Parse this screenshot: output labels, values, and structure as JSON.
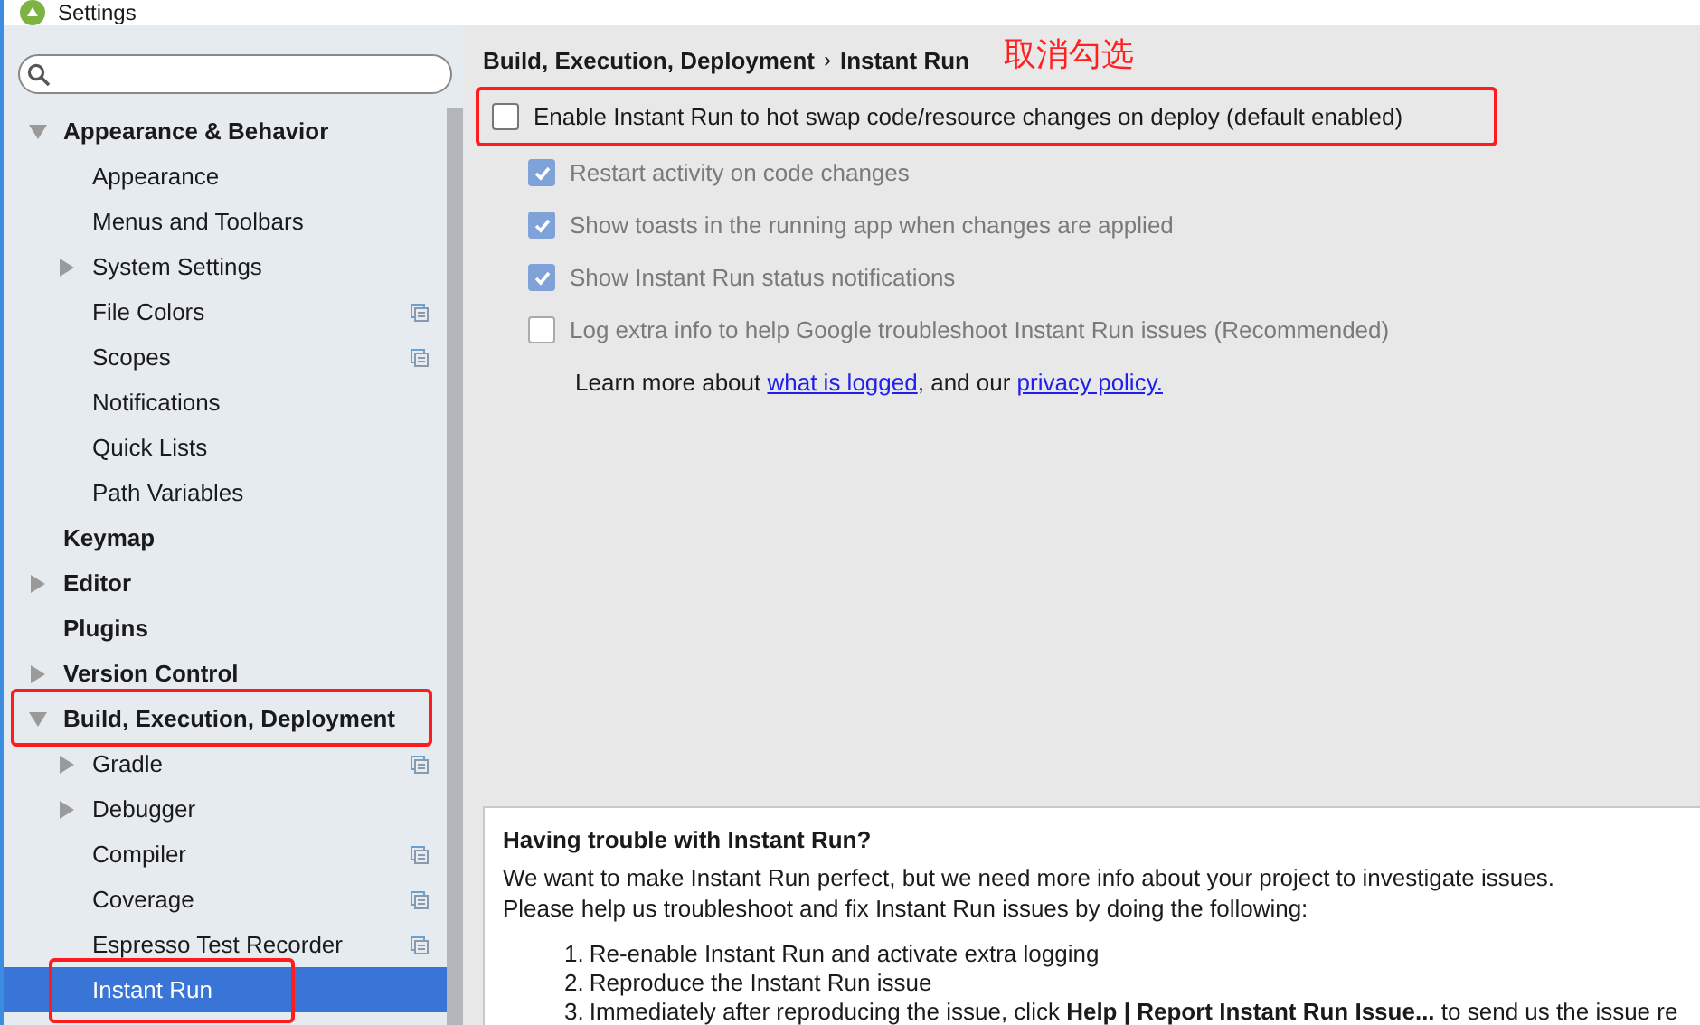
{
  "window": {
    "title": "Settings"
  },
  "sidebar": {
    "items": [
      {
        "label": "Appearance & Behavior",
        "expanded": true,
        "selected": false,
        "children": [
          {
            "label": "Appearance",
            "selected": false
          },
          {
            "label": "Menus and Toolbars",
            "selected": false
          },
          {
            "label": "System Settings",
            "expanded": false,
            "selected": false
          },
          {
            "label": "File Colors",
            "project_level": true,
            "selected": false
          },
          {
            "label": "Scopes",
            "project_level": true,
            "selected": false
          },
          {
            "label": "Notifications",
            "selected": false
          },
          {
            "label": "Quick Lists",
            "selected": false
          },
          {
            "label": "Path Variables",
            "selected": false
          }
        ]
      },
      {
        "label": "Keymap",
        "selected": false
      },
      {
        "label": "Editor",
        "expanded": false,
        "selected": false
      },
      {
        "label": "Plugins",
        "selected": false
      },
      {
        "label": "Version Control",
        "expanded": false,
        "selected": false
      },
      {
        "label": "Build, Execution, Deployment",
        "expanded": true,
        "selected": false,
        "children": [
          {
            "label": "Gradle",
            "expanded": false,
            "project_level": true,
            "selected": false
          },
          {
            "label": "Debugger",
            "expanded": false,
            "selected": false
          },
          {
            "label": "Compiler",
            "project_level": true,
            "selected": false
          },
          {
            "label": "Coverage",
            "project_level": true,
            "selected": false
          },
          {
            "label": "Espresso Test Recorder",
            "project_level": true,
            "selected": false
          },
          {
            "label": "Instant Run",
            "selected": true
          }
        ]
      }
    ]
  },
  "breadcrumb": [
    "Build, Execution, Deployment",
    "Instant Run"
  ],
  "breadcrumb_separator": "›",
  "annotation": "取消勾选",
  "options": [
    {
      "label": "Enable Instant Run to hot swap code/resource changes on deploy (default enabled)",
      "checked": false,
      "disabled": false
    },
    {
      "label": "Restart activity on code changes",
      "checked": true,
      "disabled": true
    },
    {
      "label": "Show toasts in the running app when changes are applied",
      "checked": true,
      "disabled": true
    },
    {
      "label": "Show Instant Run status notifications",
      "checked": true,
      "disabled": true
    },
    {
      "label": "Log extra info to help Google troubleshoot Instant Run issues (Recommended)",
      "checked": false,
      "disabled": true
    }
  ],
  "learn_more": [
    {
      "text": "Learn more about ",
      "kind": "text"
    },
    {
      "text": "what is logged",
      "kind": "link"
    },
    {
      "text": ", and our ",
      "kind": "text"
    },
    {
      "text": "privacy policy.",
      "kind": "link"
    }
  ],
  "help": {
    "title": "Having trouble with Instant Run?",
    "paragraph": [
      "We want to make Instant Run perfect, but we need more info about your project to investigate issues.",
      "Please help us troubleshoot and fix Instant Run issues by doing the following:"
    ],
    "steps": [
      {
        "number": "1.",
        "text": "Re-enable Instant Run and activate extra logging"
      },
      {
        "number": "2.",
        "text": "Reproduce the Instant Run issue"
      },
      {
        "number": "3.",
        "text": "Immediately after reproducing the issue, click **Help | Report Instant Run Issue...** to send us the issue re"
      }
    ]
  }
}
